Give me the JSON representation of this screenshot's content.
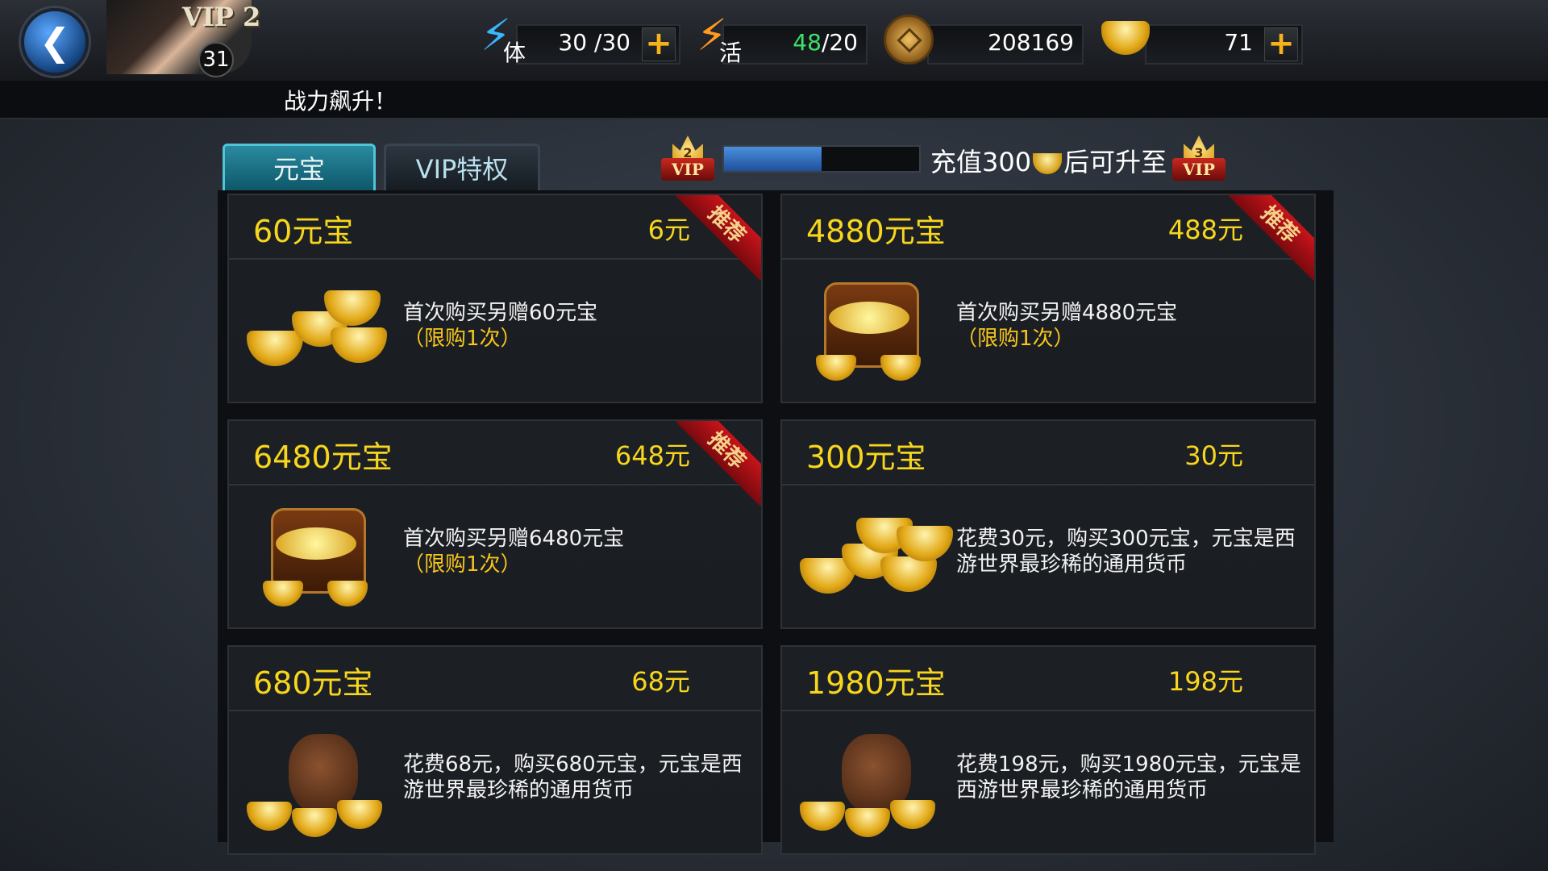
{
  "header": {
    "vip_label": "VIP 2",
    "level": "31",
    "stamina": {
      "icon": "lightning-icon",
      "label": "体",
      "value": "30 /30"
    },
    "vitality": {
      "icon": "flame-lightning-icon",
      "label": "活",
      "value_current": "48",
      "value_max": "/20"
    },
    "coins": {
      "icon": "coin-icon",
      "value": "208169"
    },
    "ingots": {
      "icon": "gold-ingot-icon",
      "value": "71"
    },
    "plus_label": "+"
  },
  "marquee": {
    "text": "战力飙升！"
  },
  "tabs": [
    {
      "label": "元宝",
      "active": true
    },
    {
      "label": "VIP特权",
      "active": false
    }
  ],
  "vip_progress": {
    "current_vip": "2",
    "next_vip": "3",
    "vip_text": "VIP",
    "progress": 0.5,
    "text_before": "充值300",
    "text_after": "后可升至"
  },
  "products": [
    {
      "amount": "60元宝",
      "price": "6元",
      "recommended": true,
      "art": "ingot-pile-small",
      "desc": "首次购买另赠60元宝",
      "limit": "（限购1次）"
    },
    {
      "amount": "4880元宝",
      "price": "488元",
      "recommended": true,
      "art": "treasure-chest",
      "desc": "首次购买另赠4880元宝",
      "limit": "（限购1次）"
    },
    {
      "amount": "6480元宝",
      "price": "648元",
      "recommended": true,
      "art": "treasure-chest",
      "desc": "首次购买另赠6480元宝",
      "limit": "（限购1次）"
    },
    {
      "amount": "300元宝",
      "price": "30元",
      "recommended": false,
      "art": "ingot-pile-large",
      "desc": "花费30元，购买300元宝，元宝是西游世界最珍稀的通用货币",
      "limit": ""
    },
    {
      "amount": "680元宝",
      "price": "68元",
      "recommended": false,
      "art": "money-bag",
      "desc": "花费68元，购买680元宝，元宝是西游世界最珍稀的通用货币",
      "limit": ""
    },
    {
      "amount": "1980元宝",
      "price": "198元",
      "recommended": false,
      "art": "money-bag",
      "desc": "花费198元，购买1980元宝，元宝是西游世界最珍稀的通用货币",
      "limit": ""
    }
  ],
  "recommend_tag": "推荐"
}
